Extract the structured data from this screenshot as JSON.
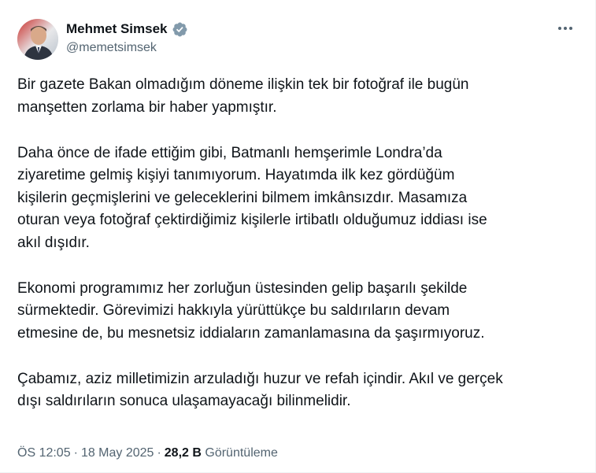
{
  "author": {
    "display_name": "Mehmet Simsek",
    "handle": "@memetsimsek",
    "verified_badge_icon": "verified-badge-icon",
    "badge_color": "#829aab",
    "avatar_icon": "avatar-portrait"
  },
  "menu": {
    "more_icon": "more-horizontal-icon"
  },
  "tweet": {
    "paragraphs": [
      {
        "lines": [
          "Bir gazete Bakan olmadığım döneme ilişkin tek bir fotoğraf ile bugün",
          "manşetten zorlama bir haber yapmıştır."
        ]
      },
      {
        "lines": [
          "Daha önce de ifade ettiğim gibi, Batmanlı hemşerimle Londra’da",
          "ziyaretime gelmiş kişiyi tanımıyorum. Hayatımda ilk kez gördüğüm",
          "kişilerin geçmişlerini ve geleceklerini bilmem imkânsızdır. Masamıza",
          "oturan veya fotoğraf çektirdiğimiz kişilerle irtibatlı olduğumuz iddiası ise",
          "akıl dışıdır."
        ]
      },
      {
        "lines": [
          "Ekonomi programımız her zorluğun üstesinden gelip başarılı şekilde",
          "sürmektedir. Görevimizi hakkıyla yürüttükçe bu saldırıların devam",
          "etmesine de, bu mesnetsiz iddiaların zamanlamasına da şaşırmıyoruz."
        ]
      },
      {
        "lines": [
          "Çabamız, aziz milletimizin arzuladığı huzur ve refah içindir. Akıl ve gerçek",
          "dışı saldırıların sonuca ulaşamayacağı bilinmelidir."
        ]
      }
    ]
  },
  "meta": {
    "time": "ÖS 12:05",
    "separator": "·",
    "date": "18 May 2025",
    "views_count": "28,2 B",
    "views_label": "Görüntüleme"
  }
}
